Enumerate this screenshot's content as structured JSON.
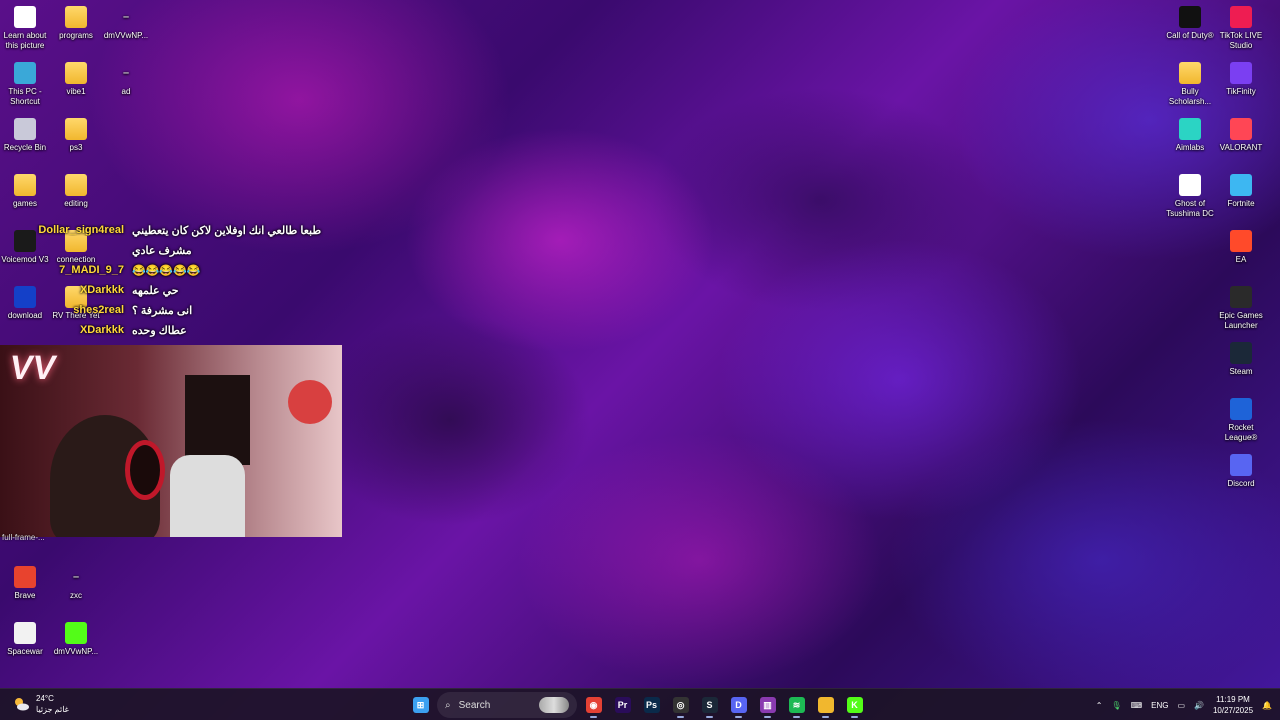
{
  "desktop": {
    "left_icons": [
      {
        "label": "Learn about this picture",
        "icon": "camera-info-icon",
        "color": "#ffffff"
      },
      {
        "label": "programs",
        "icon": "folder-icon",
        "color": "#f1b72e"
      },
      {
        "label": "dmVVwNP...",
        "icon": "shortcut-icon",
        "color": "#cccccc"
      },
      {
        "label": "This PC - Shortcut",
        "icon": "this-pc-icon",
        "color": "#3aa8d8"
      },
      {
        "label": "vibe1",
        "icon": "folder-icon",
        "color": "#f1b72e"
      },
      {
        "label": "ad",
        "icon": "shortcut-icon",
        "color": "#cccccc"
      },
      {
        "label": "Recycle Bin",
        "icon": "recycle-bin-icon",
        "color": "#c9c9d9"
      },
      {
        "label": "ps3",
        "icon": "folder-icon",
        "color": "#f1b72e"
      },
      {
        "label": "games",
        "icon": "folder-icon",
        "color": "#f1b72e"
      },
      {
        "label": "editing",
        "icon": "folder-icon",
        "color": "#f1b72e"
      },
      {
        "label": "Voicemod V3",
        "icon": "voicemod-icon",
        "color": "#1a1a1a"
      },
      {
        "label": "connection",
        "icon": "folder-icon",
        "color": "#f1b72e"
      },
      {
        "label": "download",
        "icon": "download-icon",
        "color": "#1440c8"
      },
      {
        "label": "RV There Yet",
        "icon": "folder-icon",
        "color": "#f1b72e"
      },
      {
        "label": "Brave",
        "icon": "brave-icon",
        "color": "#e8432e"
      },
      {
        "label": "zxc",
        "icon": "shortcut-icon",
        "color": "#cccccc"
      },
      {
        "label": "Spacewar",
        "icon": "file-icon",
        "color": "#f2f2f2"
      },
      {
        "label": "dmVVwNP...",
        "icon": "kick-icon",
        "color": "#53fc18"
      }
    ],
    "right_icons": [
      {
        "label": "Call of Duty®",
        "icon": "call-of-duty-icon",
        "color": "#111111"
      },
      {
        "label": "TikTok LIVE Studio",
        "icon": "tiktok-live-icon",
        "color": "#ee1d52"
      },
      {
        "label": "Bully Scholarsh...",
        "icon": "folder-icon",
        "color": "#f1b72e"
      },
      {
        "label": "TikFinity",
        "icon": "tikfinity-icon",
        "color": "#7b3ff2"
      },
      {
        "label": "Aimlabs",
        "icon": "aimlabs-icon",
        "color": "#2bd4c4"
      },
      {
        "label": "VALORANT",
        "icon": "valorant-icon",
        "color": "#ff4655"
      },
      {
        "label": "Ghost of Tsushima DC",
        "icon": "ghost-of-tsushima-icon",
        "color": "#ffffff"
      },
      {
        "label": "Fortnite",
        "icon": "fortnite-icon",
        "color": "#3db7f2"
      },
      {
        "label": "EA",
        "icon": "ea-icon",
        "color": "#ff4a2a"
      },
      {
        "label": "Epic Games Launcher",
        "icon": "epic-games-icon",
        "color": "#2a2a2a"
      },
      {
        "label": "Steam",
        "icon": "steam-icon",
        "color": "#1b2838"
      },
      {
        "label": "Rocket League®",
        "icon": "rocket-league-icon",
        "color": "#1e63d8"
      },
      {
        "label": "Discord",
        "icon": "discord-icon",
        "color": "#5865f2"
      }
    ]
  },
  "chat": [
    {
      "user": "Dollar_sign4real",
      "msg": "طبعا طالعي انك اوفلاين لاكن كان يتعطيني"
    },
    {
      "user": "",
      "msg": "مشرف عادي"
    },
    {
      "user": "7_MADI_9_7",
      "msg": "😂😂😂😂😂"
    },
    {
      "user": "XDarkkk",
      "msg": "حي علمهه"
    },
    {
      "user": "shes2real",
      "msg": "انی مشرفة ؟"
    },
    {
      "user": "XDarkkk",
      "msg": "عطاك وحده"
    }
  ],
  "webcam": {
    "label": "full-frame-..."
  },
  "taskbar": {
    "weather": {
      "temp": "24°C",
      "desc": "غائم جزئيا"
    },
    "search_placeholder": "Search",
    "apps": [
      {
        "name": "start-button",
        "icon": "windows-start-icon",
        "glyph": "⊞",
        "color": "#3ca0f0"
      },
      {
        "name": "chrome",
        "icon": "chrome-icon",
        "glyph": "◉",
        "color": "#e44134"
      },
      {
        "name": "premiere-pro",
        "icon": "premiere-pro-icon",
        "glyph": "Pr",
        "color": "#2a0c5a"
      },
      {
        "name": "photoshop",
        "icon": "photoshop-icon",
        "glyph": "Ps",
        "color": "#0a2a4a"
      },
      {
        "name": "obs",
        "icon": "obs-icon",
        "glyph": "◎",
        "color": "#333333"
      },
      {
        "name": "steam",
        "icon": "steam-icon",
        "glyph": "S",
        "color": "#1b2838"
      },
      {
        "name": "discord",
        "icon": "discord-icon",
        "glyph": "D",
        "color": "#5865f2"
      },
      {
        "name": "winrar",
        "icon": "winrar-icon",
        "glyph": "▥",
        "color": "#8a3ab0"
      },
      {
        "name": "spotify",
        "icon": "spotify-icon",
        "glyph": "≋",
        "color": "#1db954"
      },
      {
        "name": "file-explorer",
        "icon": "folder-icon",
        "glyph": "",
        "color": "#f1b72e"
      },
      {
        "name": "kick",
        "icon": "kick-icon",
        "glyph": "K",
        "color": "#53fc18"
      }
    ],
    "tray": {
      "lang": "ENG",
      "time": "11:19 PM",
      "date": "10/27/2025"
    }
  }
}
